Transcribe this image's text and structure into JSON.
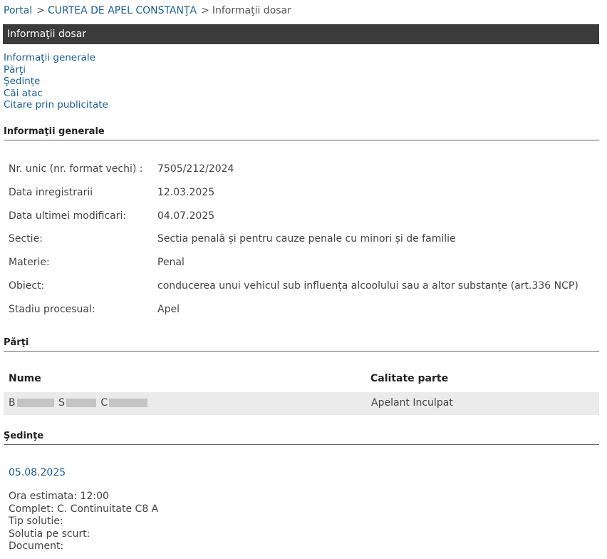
{
  "breadcrumb": {
    "portal": "Portal",
    "court": "CURTEA DE APEL CONSTANŢA",
    "current": "Informaţii dosar",
    "separator": ">"
  },
  "title": "Informaţii dosar",
  "toc": [
    "Informaţii generale",
    "Părţi",
    "Şedinţe",
    "Căi atac",
    "Citare prin publicitate"
  ],
  "general": {
    "heading": "Informaţii generale",
    "rows": [
      {
        "label": "Nr. unic (nr. format vechi) :",
        "value": "7505/212/2024"
      },
      {
        "label": "Data inregistrarii",
        "value": "12.03.2025"
      },
      {
        "label": "Data ultimei modificari:",
        "value": "04.07.2025"
      },
      {
        "label": "Sectie:",
        "value": "Sectia penală și pentru cauze penale cu minori și de familie"
      },
      {
        "label": "Materie:",
        "value": "Penal"
      },
      {
        "label": "Obiect:",
        "value": "conducerea unui vehicul sub influența alcoolului sau a altor substanțe (art.336 NCP)"
      },
      {
        "label": "Stadiu procesual:",
        "value": "Apel"
      }
    ]
  },
  "parti": {
    "heading": "Părţi",
    "columns": [
      "Nume",
      "Calitate parte"
    ],
    "rows": [
      {
        "initials": [
          "B",
          "S",
          "C"
        ],
        "calitate": "Apelant Inculpat"
      }
    ]
  },
  "sedinte": {
    "heading": "Şedinţe",
    "date": "05.08.2025",
    "lines": [
      "Ora estimata: 12:00",
      "Complet: C. Continuitate C8 A",
      "Tip solutie:",
      "Solutia pe scurt:",
      "Document:"
    ]
  }
}
